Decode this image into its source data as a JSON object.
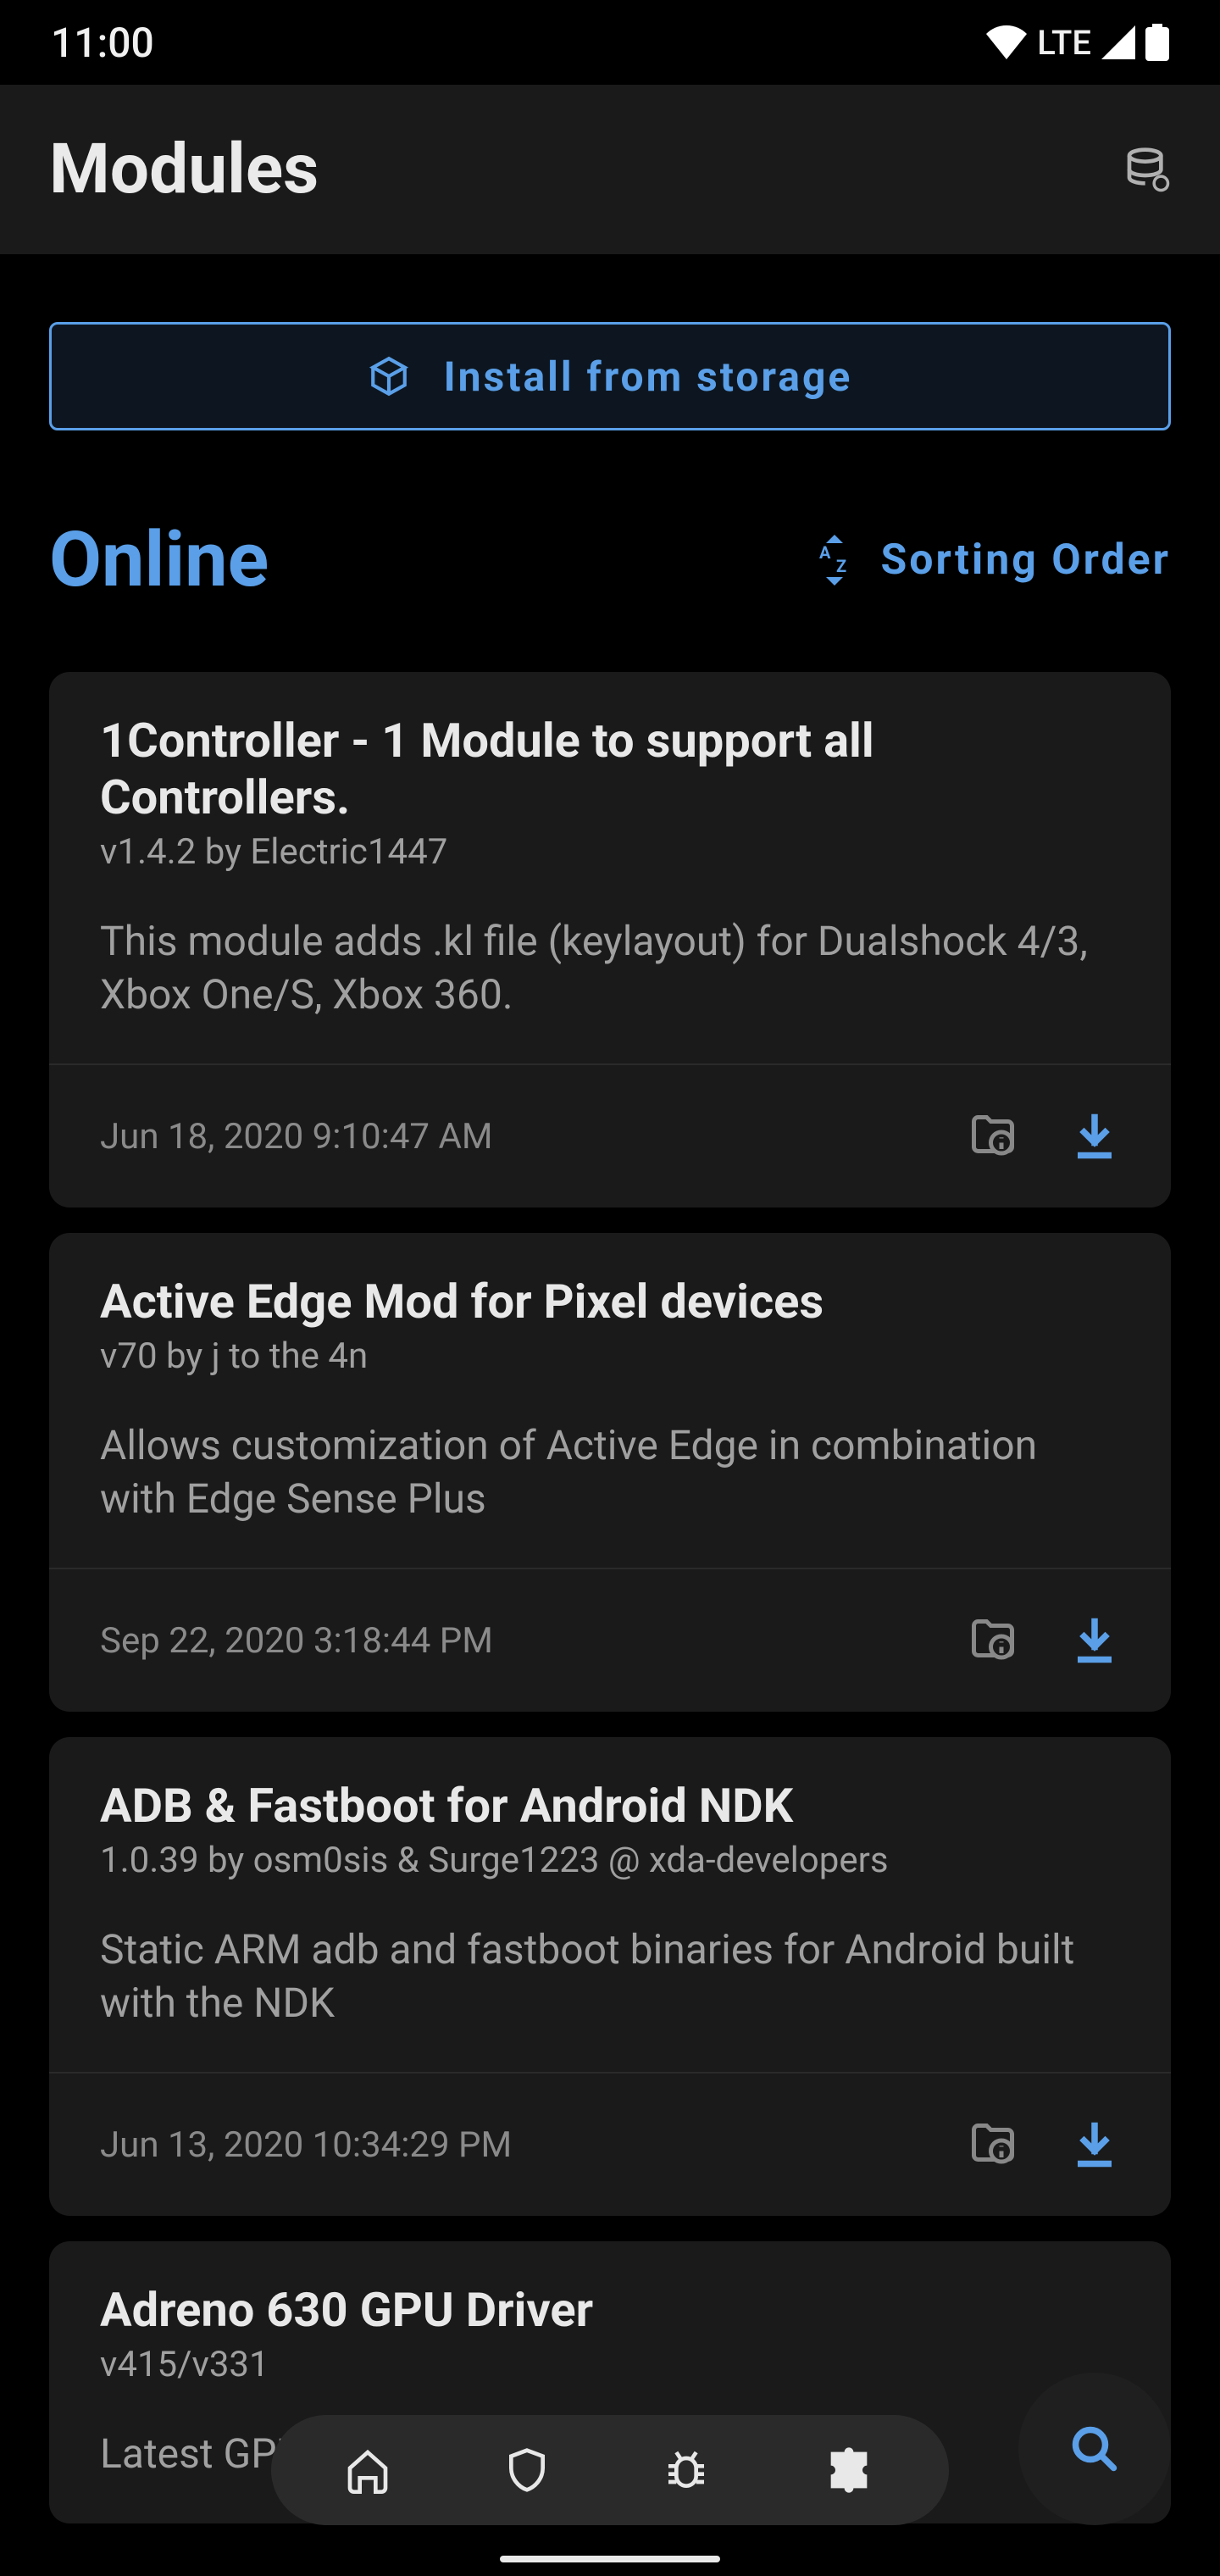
{
  "status": {
    "time": "11:00",
    "network": "LTE"
  },
  "header": {
    "title": "Modules"
  },
  "install_button": {
    "label": "Install from storage"
  },
  "section": {
    "title": "Online",
    "sort_label": "Sorting Order"
  },
  "modules": [
    {
      "title": "1Controller - 1 Module to support all Controllers.",
      "subtitle": "v1.4.2 by Electric1447",
      "description": "This module adds .kl file (keylayout) for Dualshock 4/3, Xbox One/S, Xbox 360.",
      "date": "Jun 18, 2020 9:10:47 AM"
    },
    {
      "title": "Active Edge Mod for Pixel devices",
      "subtitle": "v70 by j to the 4n",
      "description": "Allows customization of Active Edge in combination with Edge Sense Plus",
      "date": "Sep 22, 2020 3:18:44 PM"
    },
    {
      "title": "ADB & Fastboot for Android NDK",
      "subtitle": "1.0.39 by osm0sis & Surge1223 @ xda-developers",
      "description": "Static ARM adb and fastboot binaries for Android built with the NDK",
      "date": "Jun 13, 2020 10:34:29 PM"
    },
    {
      "title": "Adreno 630 GPU Driver",
      "subtitle": "v415/v331",
      "description": "Latest GPU",
      "date": ""
    }
  ],
  "nav": {
    "items": [
      "home",
      "shield",
      "bug",
      "puzzle"
    ],
    "active_index": 3
  }
}
